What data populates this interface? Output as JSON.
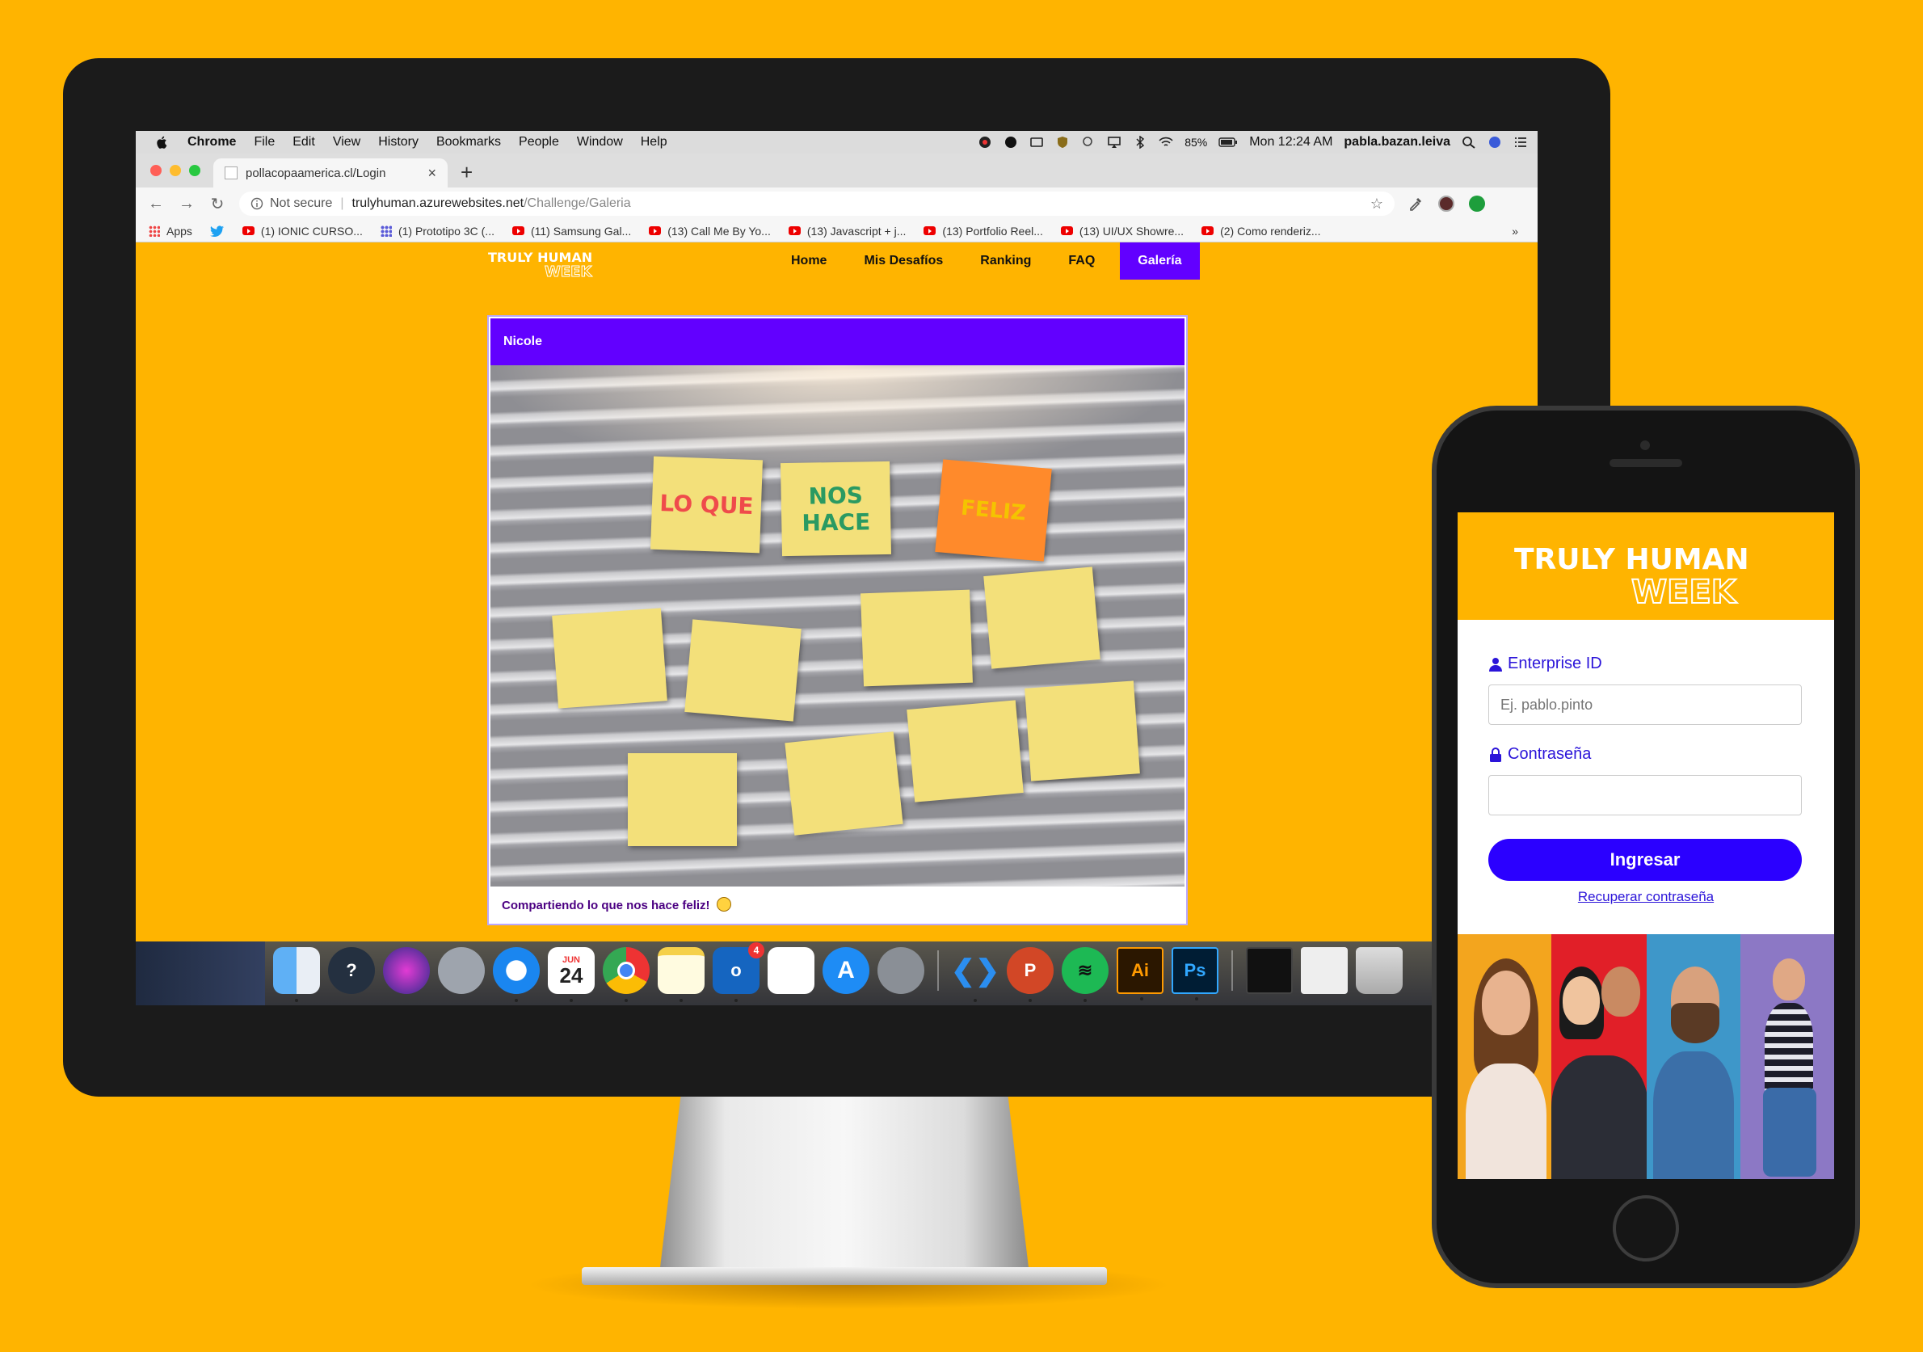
{
  "menubar": {
    "app": "Chrome",
    "items": [
      "File",
      "Edit",
      "View",
      "History",
      "Bookmarks",
      "People",
      "Window",
      "Help"
    ],
    "battery": "85%",
    "clock": "Mon 12:24 AM",
    "user": "pabla.bazan.leiva"
  },
  "tab": {
    "title": "pollacopaamerica.cl/Login"
  },
  "address": {
    "security": "Not secure",
    "host": "trulyhuman.azurewebsites.net",
    "path": "/Challenge/Galeria"
  },
  "bookmarks": {
    "apps": "Apps",
    "items": [
      "(1) IONIC CURSO...",
      "(1) Prototipo 3C (...",
      "(11) Samsung Gal...",
      "(13) Call Me By Yo...",
      "(13) Javascript + j...",
      "(13) Portfolio Reel...",
      "(13) UI/UX Showre...",
      "(2) Como renderiz..."
    ],
    "more": "»"
  },
  "site": {
    "logo_top": "TRULY HUMAN",
    "logo_bottom": "WEEK",
    "nav": [
      "Home",
      "Mis Desafíos",
      "Ranking",
      "FAQ",
      "Galería"
    ],
    "active_nav": "Galería",
    "accent": "#6200FF",
    "background": "#FFB400"
  },
  "post": {
    "author": "Nicole",
    "caption": "Compartiendo lo que nos hace feliz!",
    "notes": [
      "LO QUE",
      "NOS HACE",
      "FELIZ"
    ]
  },
  "dock": {
    "calendar_month": "JUN",
    "calendar_day": "24",
    "mail_badge": "4",
    "illustrator": "Ai",
    "photoshop": "Ps"
  },
  "phone": {
    "logo_top": "TRULY HUMAN",
    "logo_bottom": "WEEK",
    "enterprise_label": "Enterprise ID",
    "enterprise_placeholder": "Ej. pablo.pinto",
    "password_label": "Contraseña",
    "password_placeholder": "",
    "submit": "Ingresar",
    "recover": "Recuperar contraseña",
    "button_color": "#2B00FF"
  }
}
